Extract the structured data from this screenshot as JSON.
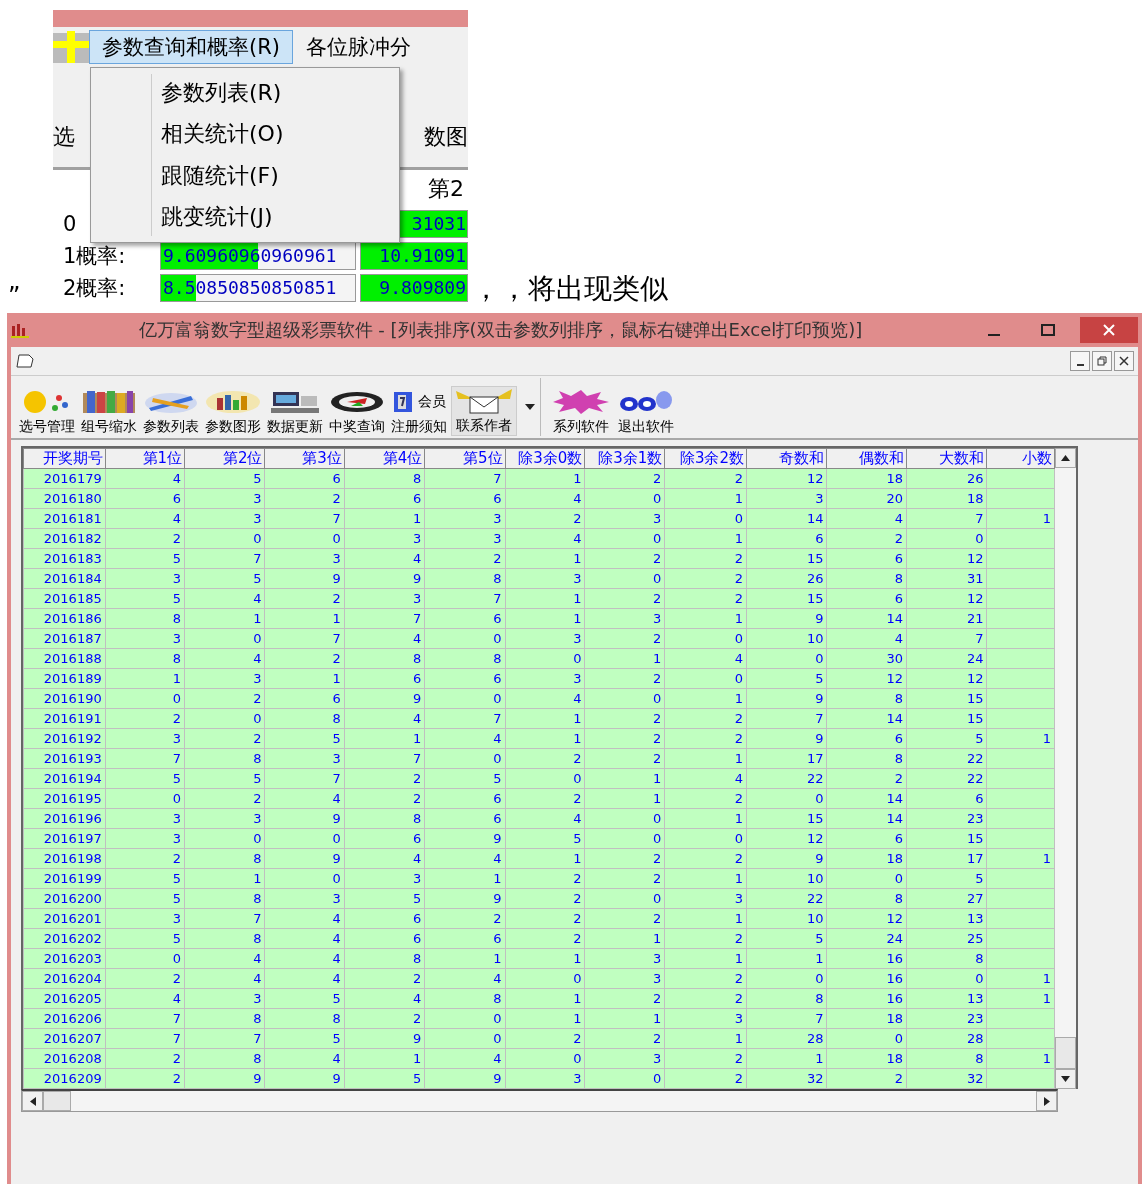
{
  "snippet": {
    "menu_bar": [
      {
        "label": "参数查询和概率(R)",
        "selected": true
      },
      {
        "label": "各位脉冲分",
        "selected": false
      }
    ],
    "menu_items": [
      "参数列表(R)",
      "相关统计(O)",
      "跟随统计(F)",
      "跳变统计(J)"
    ],
    "toolbar_labels": [
      "选",
      "数图"
    ],
    "column_header": "第2",
    "prob_rows": [
      {
        "label": "0",
        "cells": [
          {
            "value": "31031",
            "level": 1
          }
        ]
      },
      {
        "label": "1概率:",
        "cells": [
          {
            "value": "9.60960960960961",
            "level": 0.5
          },
          {
            "value": "10.91091",
            "level": 1
          }
        ]
      },
      {
        "label": "2概率:",
        "cells": [
          {
            "value": "8.50850850850851",
            "level": 0.18
          },
          {
            "value": "9.809809",
            "level": 1
          }
        ]
      }
    ]
  },
  "quote": "”",
  "caption": "，，将出现类似",
  "window": {
    "title": "亿万富翁数字型超级彩票软件 - [列表排序(双击参数列排序，鼠标右键弹出Excel打印预览)]",
    "toolbar": [
      {
        "label": "选号管理",
        "kind": "coin"
      },
      {
        "label": "组号缩水",
        "kind": "books"
      },
      {
        "label": "参数列表",
        "kind": "pen"
      },
      {
        "label": "参数图形",
        "kind": "bars"
      },
      {
        "label": "数据更新",
        "kind": "computer"
      },
      {
        "label": "中奖查询",
        "kind": "disc"
      },
      {
        "label": "注册须知",
        "kind": "page",
        "badge": "会员"
      },
      {
        "label": "联系作者",
        "kind": "envelope"
      },
      {
        "label": "系列软件",
        "kind": "burst"
      },
      {
        "label": "退出软件",
        "kind": "go"
      }
    ],
    "table": {
      "columns": [
        "开奖期号",
        "第1位",
        "第2位",
        "第3位",
        "第4位",
        "第5位",
        "除3余0数",
        "除3余1数",
        "除3余2数",
        "奇数和",
        "偶数和",
        "大数和",
        "小数"
      ],
      "rows": [
        [
          "2016179",
          "4",
          "5",
          "6",
          "8",
          "7",
          "1",
          "2",
          "2",
          "12",
          "18",
          "26"
        ],
        [
          "2016180",
          "6",
          "3",
          "2",
          "6",
          "6",
          "4",
          "0",
          "1",
          "3",
          "20",
          "18"
        ],
        [
          "2016181",
          "4",
          "3",
          "7",
          "1",
          "3",
          "2",
          "3",
          "0",
          "14",
          "4",
          "7",
          "1"
        ],
        [
          "2016182",
          "2",
          "0",
          "0",
          "3",
          "3",
          "4",
          "0",
          "1",
          "6",
          "2",
          "0"
        ],
        [
          "2016183",
          "5",
          "7",
          "3",
          "4",
          "2",
          "1",
          "2",
          "2",
          "15",
          "6",
          "12"
        ],
        [
          "2016184",
          "3",
          "5",
          "9",
          "9",
          "8",
          "3",
          "0",
          "2",
          "26",
          "8",
          "31"
        ],
        [
          "2016185",
          "5",
          "4",
          "2",
          "3",
          "7",
          "1",
          "2",
          "2",
          "15",
          "6",
          "12"
        ],
        [
          "2016186",
          "8",
          "1",
          "1",
          "7",
          "6",
          "1",
          "3",
          "1",
          "9",
          "14",
          "21"
        ],
        [
          "2016187",
          "3",
          "0",
          "7",
          "4",
          "0",
          "3",
          "2",
          "0",
          "10",
          "4",
          "7"
        ],
        [
          "2016188",
          "8",
          "4",
          "2",
          "8",
          "8",
          "0",
          "1",
          "4",
          "0",
          "30",
          "24"
        ],
        [
          "2016189",
          "1",
          "3",
          "1",
          "6",
          "6",
          "3",
          "2",
          "0",
          "5",
          "12",
          "12"
        ],
        [
          "2016190",
          "0",
          "2",
          "6",
          "9",
          "0",
          "4",
          "0",
          "1",
          "9",
          "8",
          "15"
        ],
        [
          "2016191",
          "2",
          "0",
          "8",
          "4",
          "7",
          "1",
          "2",
          "2",
          "7",
          "14",
          "15"
        ],
        [
          "2016192",
          "3",
          "2",
          "5",
          "1",
          "4",
          "1",
          "2",
          "2",
          "9",
          "6",
          "5",
          "1"
        ],
        [
          "2016193",
          "7",
          "8",
          "3",
          "7",
          "0",
          "2",
          "2",
          "1",
          "17",
          "8",
          "22"
        ],
        [
          "2016194",
          "5",
          "5",
          "7",
          "2",
          "5",
          "0",
          "1",
          "4",
          "22",
          "2",
          "22"
        ],
        [
          "2016195",
          "0",
          "2",
          "4",
          "2",
          "6",
          "2",
          "1",
          "2",
          "0",
          "14",
          "6"
        ],
        [
          "2016196",
          "3",
          "3",
          "9",
          "8",
          "6",
          "4",
          "0",
          "1",
          "15",
          "14",
          "23"
        ],
        [
          "2016197",
          "3",
          "0",
          "0",
          "6",
          "9",
          "5",
          "0",
          "0",
          "12",
          "6",
          "15"
        ],
        [
          "2016198",
          "2",
          "8",
          "9",
          "4",
          "4",
          "1",
          "2",
          "2",
          "9",
          "18",
          "17",
          "1"
        ],
        [
          "2016199",
          "5",
          "1",
          "0",
          "3",
          "1",
          "2",
          "2",
          "1",
          "10",
          "0",
          "5"
        ],
        [
          "2016200",
          "5",
          "8",
          "3",
          "5",
          "9",
          "2",
          "0",
          "3",
          "22",
          "8",
          "27"
        ],
        [
          "2016201",
          "3",
          "7",
          "4",
          "6",
          "2",
          "2",
          "2",
          "1",
          "10",
          "12",
          "13"
        ],
        [
          "2016202",
          "5",
          "8",
          "4",
          "6",
          "6",
          "2",
          "1",
          "2",
          "5",
          "24",
          "25"
        ],
        [
          "2016203",
          "0",
          "4",
          "4",
          "8",
          "1",
          "1",
          "3",
          "1",
          "1",
          "16",
          "8"
        ],
        [
          "2016204",
          "2",
          "4",
          "4",
          "2",
          "4",
          "0",
          "3",
          "2",
          "0",
          "16",
          "0",
          "1"
        ],
        [
          "2016205",
          "4",
          "3",
          "5",
          "4",
          "8",
          "1",
          "2",
          "2",
          "8",
          "16",
          "13",
          "1"
        ],
        [
          "2016206",
          "7",
          "8",
          "8",
          "2",
          "0",
          "1",
          "1",
          "3",
          "7",
          "18",
          "23"
        ],
        [
          "2016207",
          "7",
          "7",
          "5",
          "9",
          "0",
          "2",
          "2",
          "1",
          "28",
          "0",
          "28"
        ],
        [
          "2016208",
          "2",
          "8",
          "4",
          "1",
          "4",
          "0",
          "3",
          "2",
          "1",
          "18",
          "8",
          "1"
        ],
        [
          "2016209",
          "2",
          "9",
          "9",
          "5",
          "9",
          "3",
          "0",
          "2",
          "32",
          "2",
          "32"
        ]
      ]
    }
  }
}
